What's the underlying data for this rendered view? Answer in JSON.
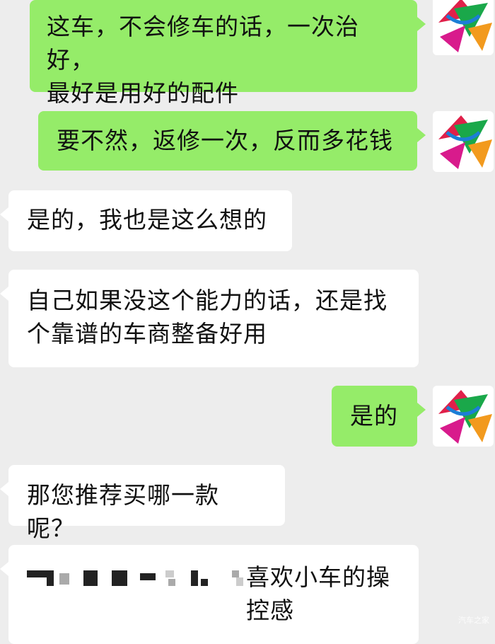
{
  "chat": {
    "messages": [
      {
        "side": "mine",
        "text": "这车，不会修车的话，一次治好，\n最好是用好的配件"
      },
      {
        "side": "mine",
        "text": "要不然，返修一次，反而多花钱"
      },
      {
        "side": "theirs",
        "text": "是的，我也是这么想的"
      },
      {
        "side": "theirs",
        "text": "自己如果没这个能力的话，还是找\n个靠谱的车商整备好用"
      },
      {
        "side": "mine",
        "text": "是的"
      },
      {
        "side": "theirs",
        "text": "那您推荐买哪一款呢？"
      },
      {
        "side": "theirs",
        "text_visible": "喜欢小车的操\n控感",
        "redacted_prefix": true
      }
    ]
  },
  "avatar": {
    "icon": "colorful-logo-avatar"
  },
  "watermark": "汽车之家",
  "colors": {
    "background": "#ededed",
    "mine_bubble": "#95ec69",
    "theirs_bubble": "#ffffff"
  }
}
